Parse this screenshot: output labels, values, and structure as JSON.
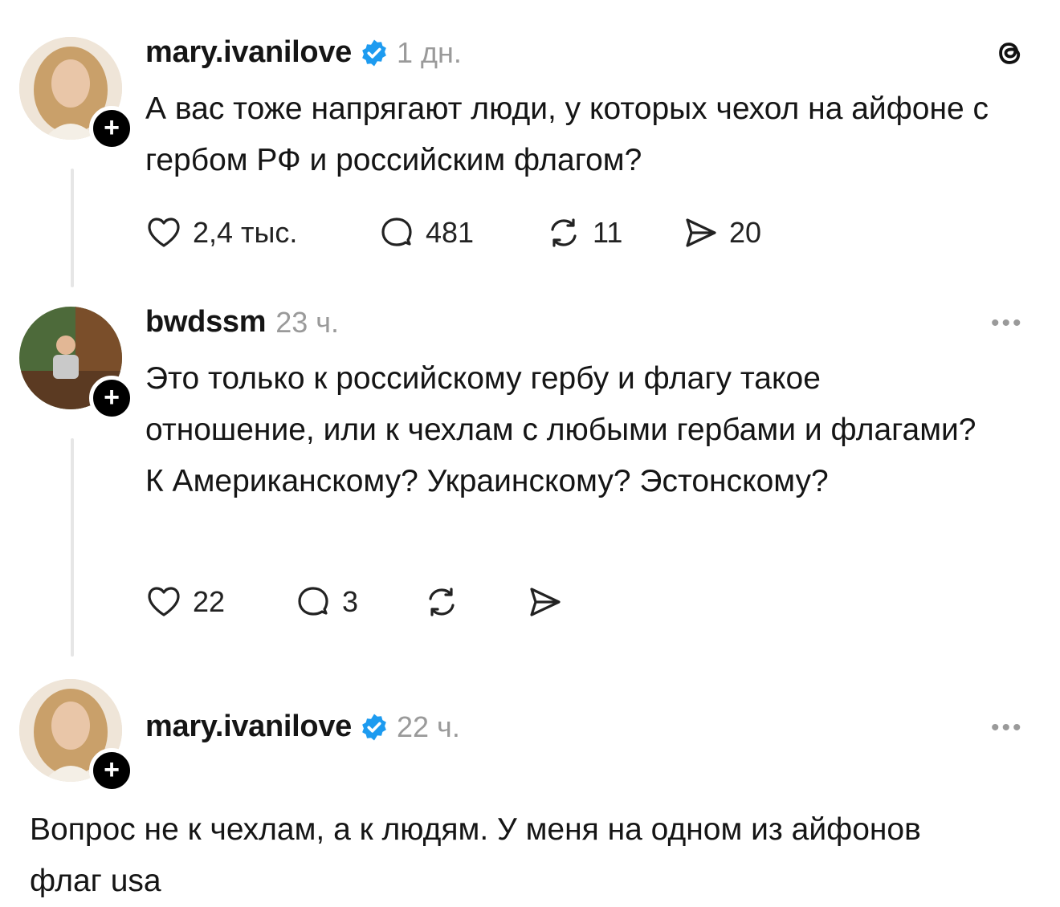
{
  "posts": [
    {
      "username": "mary.ivanilove",
      "verified": true,
      "time": "1 дн.",
      "text": "А вас тоже напрягают люди, у которых чехол на айфоне с гербом РФ и российским флагом?",
      "likes": "2,4 тыс.",
      "comments": "481",
      "reposts": "11",
      "shares": "20",
      "corner_icon": "threads-logo-icon"
    },
    {
      "username": "bwdssm",
      "verified": false,
      "time": "23 ч.",
      "text": "Это только к российскому гербу и флагу такое отношение, или к чехлам с любыми гербами и флагами? К Американскому? Украинскому? Эстонскому?",
      "likes": "22",
      "comments": "3",
      "more": "•••"
    },
    {
      "username": "mary.ivanilove",
      "verified": true,
      "time": "22 ч.",
      "text": "Вопрос не к чехлам, а к людям. У меня на одном из айфонов флаг usa",
      "more": "•••"
    }
  ],
  "colors": {
    "verified": "#1d9bf0",
    "muted": "#9a9a9a",
    "thread_line": "#e6e6e6"
  }
}
